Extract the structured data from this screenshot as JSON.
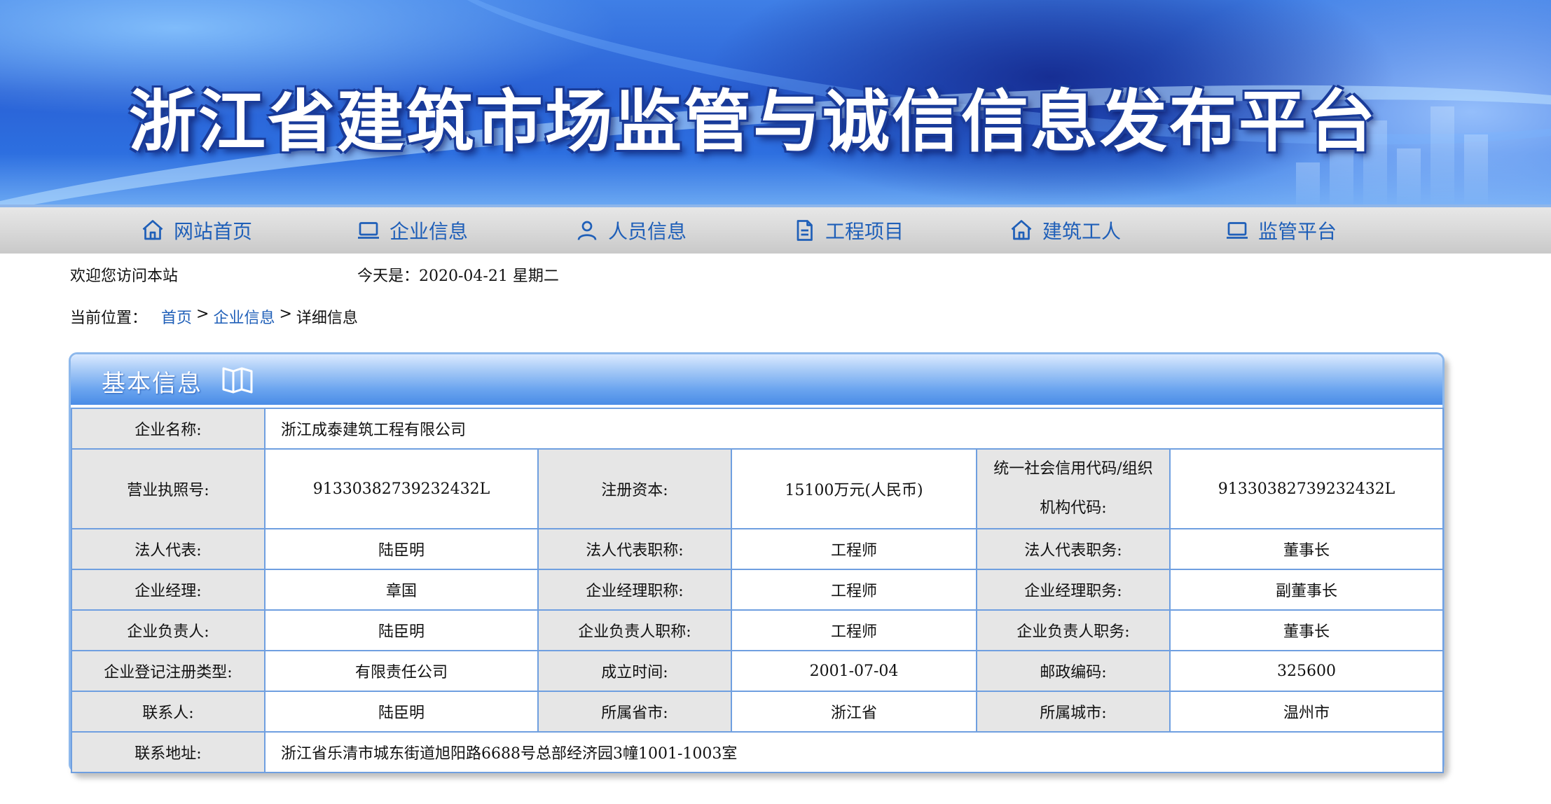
{
  "banner": {
    "title": "浙江省建筑市场监管与诚信信息发布平台"
  },
  "nav": {
    "items": [
      {
        "label": "网站首页",
        "icon": "home-icon"
      },
      {
        "label": "企业信息",
        "icon": "laptop-icon"
      },
      {
        "label": "人员信息",
        "icon": "person-icon"
      },
      {
        "label": "工程项目",
        "icon": "project-icon"
      },
      {
        "label": "建筑工人",
        "icon": "home-icon"
      },
      {
        "label": "监管平台",
        "icon": "laptop-icon"
      }
    ]
  },
  "info": {
    "welcome": "欢迎您访问本站",
    "today": "今天是：2020-04-21 星期二"
  },
  "breadcrumb": {
    "prefix": "当前位置：",
    "home": "首页",
    "sep1": ">",
    "section": "企业信息",
    "sep2": ">",
    "current": "详细信息"
  },
  "panel": {
    "title": "基本信息",
    "rows": {
      "name_label": "企业名称:",
      "name_value": "浙江成泰建筑工程有限公司",
      "license_label": "营业执照号:",
      "license_value": "91330382739232432L",
      "capital_label": "注册资本:",
      "capital_value": "15100万元(人民币)",
      "credit_label": "统一社会信用代码/组织机构代码:",
      "credit_value": "91330382739232432L",
      "legal_label": "法人代表:",
      "legal_value": "陆臣明",
      "legal_title_label": "法人代表职称:",
      "legal_title_value": "工程师",
      "legal_post_label": "法人代表职务:",
      "legal_post_value": "董事长",
      "manager_label": "企业经理:",
      "manager_value": "章国",
      "manager_title_label": "企业经理职称:",
      "manager_title_value": "工程师",
      "manager_post_label": "企业经理职务:",
      "manager_post_value": "副董事长",
      "head_label": "企业负责人:",
      "head_value": "陆臣明",
      "head_title_label": "企业负责人职称:",
      "head_title_value": "工程师",
      "head_post_label": "企业负责人职务:",
      "head_post_value": "董事长",
      "regtype_label": "企业登记注册类型:",
      "regtype_value": "有限责任公司",
      "founded_label": "成立时间:",
      "founded_value": "2001-07-04",
      "postcode_label": "邮政编码:",
      "postcode_value": "325600",
      "contact_label": "联系人:",
      "contact_value": "陆臣明",
      "province_label": "所属省市:",
      "province_value": "浙江省",
      "city_label": "所属城市:",
      "city_value": "温州市",
      "address_label": "联系地址:",
      "address_value": "浙江省乐清市城东街道旭阳路6688号总部经济园3幢1001-1003室"
    }
  },
  "colors": {
    "link": "#1f5fb8",
    "table_border": "#6f9fe0",
    "label_bg": "#e6e6e6",
    "panel_border": "#8db8ec"
  }
}
